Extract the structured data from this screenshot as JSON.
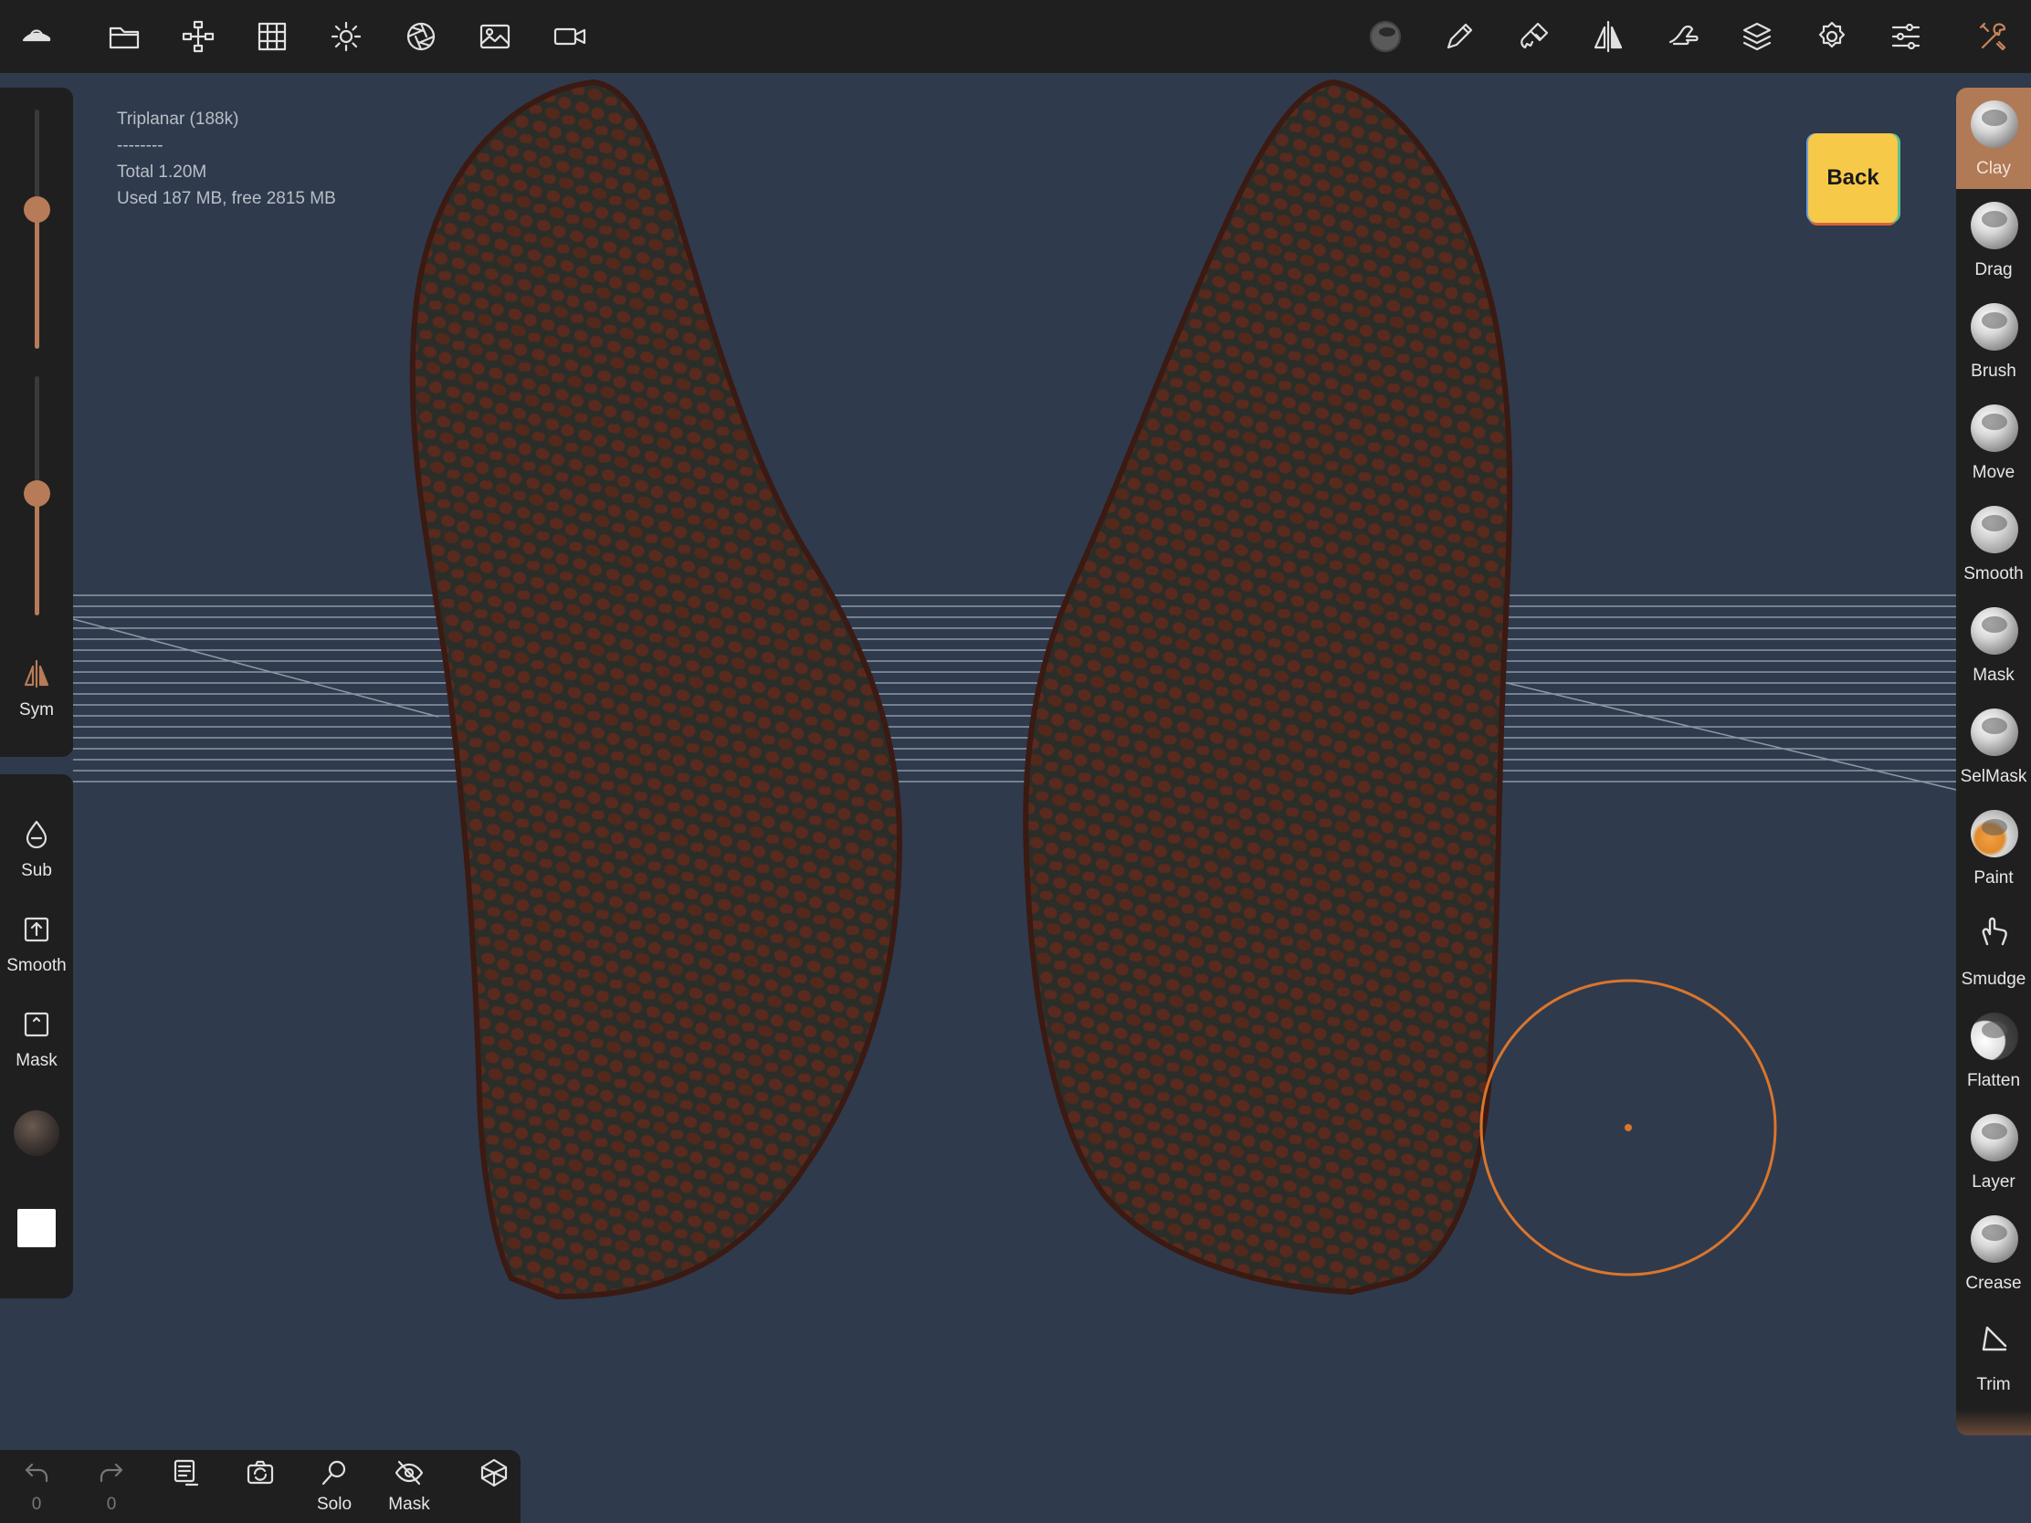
{
  "stats": {
    "line1": "Triplanar (188k)",
    "line2": "--------",
    "line3": "Total 1.20M",
    "line4": "Used 187 MB,  free 2815 MB"
  },
  "topbar": {
    "left_icons": [
      "app-logo-icon",
      "folder-icon",
      "scene-tree-icon",
      "grid-icon",
      "sun-icon",
      "aperture-icon",
      "image-icon",
      "camera-icon"
    ],
    "right_icons": [
      "material-sphere-icon",
      "pen-icon",
      "paint-brush-icon",
      "symmetry-icon",
      "hand-icon",
      "layers-icon",
      "gear-icon",
      "sliders-icon",
      "tools-icon"
    ]
  },
  "left_panel": {
    "sym_label": "Sym",
    "sub_label": "Sub",
    "smooth_label": "Smooth",
    "mask_label": "Mask",
    "radius_level": 0.4,
    "intensity_level": 0.5
  },
  "back_button": {
    "label": "Back"
  },
  "brushes": [
    {
      "label": "Clay",
      "active": true
    },
    {
      "label": "Drag",
      "active": false
    },
    {
      "label": "Brush",
      "active": false
    },
    {
      "label": "Move",
      "active": false
    },
    {
      "label": "Smooth",
      "active": false
    },
    {
      "label": "Mask",
      "active": false
    },
    {
      "label": "SelMask",
      "active": false
    },
    {
      "label": "Paint",
      "active": false
    },
    {
      "label": "Smudge",
      "active": false
    },
    {
      "label": "Flatten",
      "active": false
    },
    {
      "label": "Layer",
      "active": false
    },
    {
      "label": "Crease",
      "active": false
    },
    {
      "label": "Trim",
      "active": false
    }
  ],
  "bottombar": {
    "undo_count": "0",
    "redo_count": "0",
    "solo_label": "Solo",
    "mask_label": "Mask"
  },
  "colors": {
    "accent": "#b77b58",
    "background": "#2f3a4c",
    "panel": "#1f1f1f",
    "wing_base": "#5a2a1e",
    "wing_vein": "#2b2e28",
    "cursor": "#d9752c",
    "back_button": "#f7c948"
  }
}
